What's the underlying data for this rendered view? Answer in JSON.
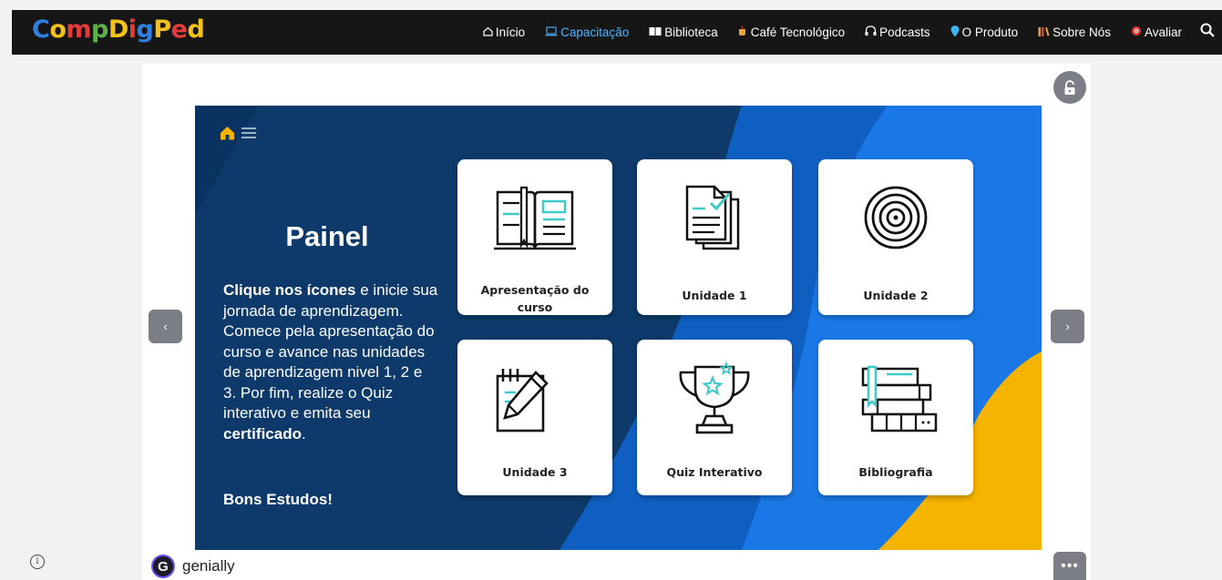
{
  "brand": {
    "logo_text": "CompDigPed",
    "logo_colors": [
      "#2f7fe0",
      "#f2c21a",
      "#e83a3a",
      "#5db34a",
      "#f2c21a",
      "#e83a3a",
      "#2f7fe0",
      "#f2c21a",
      "#e83a3a",
      "#f2c21a"
    ]
  },
  "nav": {
    "items": [
      {
        "label": "Início",
        "icon": "home-icon",
        "active": false
      },
      {
        "label": "Capacitação",
        "icon": "laptop-icon",
        "active": true
      },
      {
        "label": "Biblioteca",
        "icon": "book-icon",
        "active": false
      },
      {
        "label": "Café Tecnológico",
        "icon": "coffee-icon",
        "active": false
      },
      {
        "label": "Podcasts",
        "icon": "headphones-icon",
        "active": false
      },
      {
        "label": "O Produto",
        "icon": "map-pin-icon",
        "active": false
      },
      {
        "label": "Sobre Nós",
        "icon": "books-icon",
        "active": false
      },
      {
        "label": "Avaliar",
        "icon": "target-icon",
        "active": false
      }
    ],
    "search_icon": "search-icon"
  },
  "slide": {
    "title": "Painel",
    "intro_bold": "Clique nos ícones",
    "intro_rest": " e inicie sua jornada de aprendizagem. Comece pela apresentação do curso e avance nas unidades de aprendizagem nivel 1, 2 e 3. Por fim, realize o Quiz interativo e emita seu ",
    "intro_bold_end": "certificado",
    "intro_end": ".",
    "closing": "Bons Estudos!",
    "cards": [
      {
        "label": "Apresentação do curso",
        "icon": "open-book-icon"
      },
      {
        "label": "Unidade 1",
        "icon": "documents-icon"
      },
      {
        "label": "Unidade 2",
        "icon": "target-icon"
      },
      {
        "label": "Unidade 3",
        "icon": "notepad-pencil-icon"
      },
      {
        "label": "Quiz Interativo",
        "icon": "trophy-icon"
      },
      {
        "label": "Bibliografia",
        "icon": "book-stack-icon"
      }
    ]
  },
  "genially": {
    "label": "genially"
  },
  "colors": {
    "nav_bg": "#161616",
    "nav_active": "#4fb3ff",
    "slide_dark": "#0d3a6a",
    "slide_blue": "#1a78e6",
    "slide_yellow": "#f5b400",
    "accent_teal": "#3fc9c9"
  }
}
